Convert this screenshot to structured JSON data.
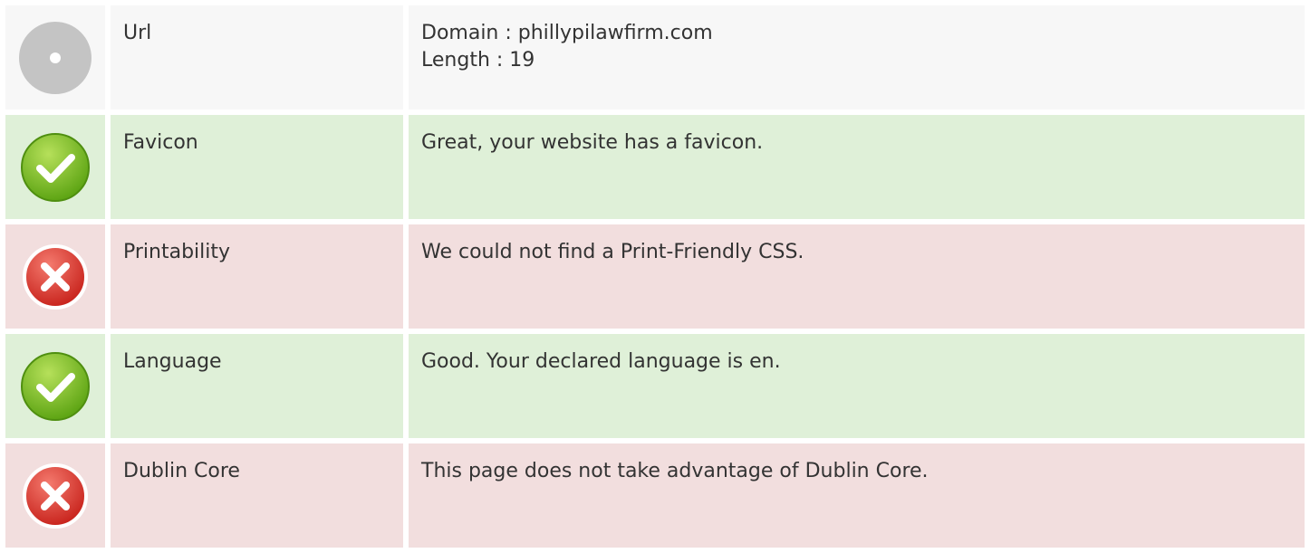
{
  "rows": [
    {
      "status": "neutral",
      "icon": "info-circle-icon",
      "label": "Url",
      "lines": [
        "Domain : phillypilawfirm.com",
        "Length : 19"
      ]
    },
    {
      "status": "pass",
      "icon": "check-icon",
      "label": "Favicon",
      "lines": [
        "Great, your website has a favicon."
      ]
    },
    {
      "status": "fail",
      "icon": "cross-icon",
      "label": "Printability",
      "lines": [
        "We could not find a Print-Friendly CSS."
      ]
    },
    {
      "status": "pass",
      "icon": "check-icon",
      "label": "Language",
      "lines": [
        "Good. Your declared language is en."
      ]
    },
    {
      "status": "fail",
      "icon": "cross-icon",
      "label": "Dublin Core",
      "lines": [
        "This page does not take advantage of Dublin Core."
      ]
    }
  ],
  "colors": {
    "neutral_bg": "#f7f7f7",
    "pass_bg": "#dff0d8",
    "fail_bg": "#f2dede",
    "pass_icon": "#7cc12a",
    "fail_icon": "#e0403a",
    "neutral_icon": "#bdbdbd"
  }
}
